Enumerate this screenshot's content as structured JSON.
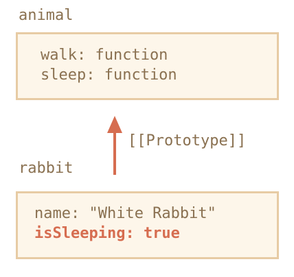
{
  "animal": {
    "title": "animal",
    "properties": [
      "walk: function",
      "sleep: function"
    ]
  },
  "link": {
    "label": "[[Prototype]]",
    "color": "#d66d50"
  },
  "rabbit": {
    "title": "rabbit",
    "properties": [
      "name: \"White Rabbit\"",
      "isSleeping: true"
    ]
  },
  "colors": {
    "text": "#8a7151",
    "highlight": "#d66d50",
    "box_fill": "#fdf6ea",
    "box_border": "#e7cba4"
  }
}
